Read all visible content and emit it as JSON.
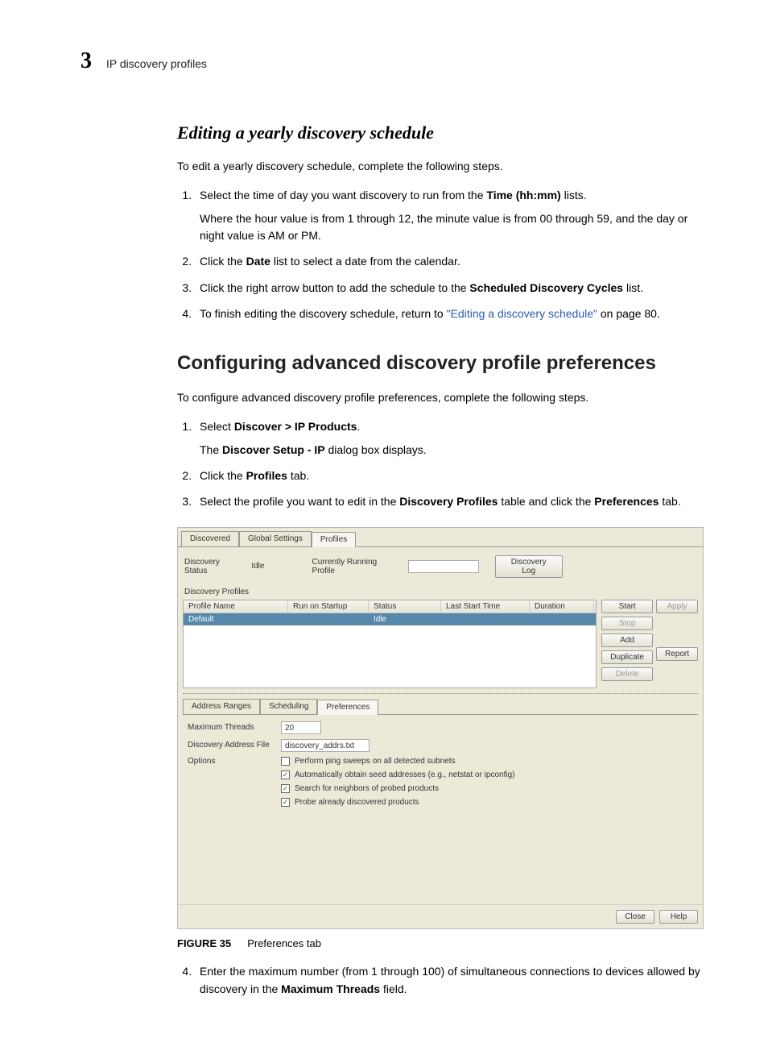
{
  "header": {
    "chapter_number": "3",
    "running_title": "IP discovery profiles"
  },
  "section1": {
    "heading": "Editing a yearly discovery schedule",
    "intro": "To edit a yearly discovery schedule, complete the following steps.",
    "steps": {
      "s1_a": "Select the time of day you want discovery to run from the ",
      "s1_bold": "Time (hh:mm)",
      "s1_b": " lists.",
      "s1_detail": "Where the hour value is from 1 through 12, the minute value is from 00 through 59, and the day or night value is AM or PM.",
      "s2_a": "Click the ",
      "s2_bold": "Date",
      "s2_b": " list to select a date from the calendar.",
      "s3_a": "Click the right arrow button to add the schedule to the ",
      "s3_bold": "Scheduled Discovery Cycles",
      "s3_b": " list.",
      "s4_a": "To finish editing the discovery schedule, return to ",
      "s4_link": "\"Editing a discovery schedule\"",
      "s4_b": " on page 80."
    }
  },
  "section2": {
    "heading": "Configuring advanced discovery profile preferences",
    "intro": "To configure advanced discovery profile preferences, complete the following steps.",
    "steps": {
      "s1_a": "Select ",
      "s1_bold": "Discover > IP Products",
      "s1_period": ".",
      "s1_detail_a": "The ",
      "s1_detail_bold": "Discover Setup - IP",
      "s1_detail_b": " dialog box displays.",
      "s2_a": "Click the ",
      "s2_bold": "Profiles",
      "s2_b": " tab.",
      "s3_a": "Select the profile you want to edit in the ",
      "s3_bold1": "Discovery Profiles",
      "s3_mid": " table and click the ",
      "s3_bold2": "Preferences",
      "s3_b": " tab.",
      "s4_a": "Enter the maximum number (from 1 through 100) of simultaneous connections to devices allowed by discovery in the ",
      "s4_bold": "Maximum Threads",
      "s4_b": " field."
    }
  },
  "dialog": {
    "top_tabs": [
      "Discovered",
      "Global Settings",
      "Profiles"
    ],
    "status": {
      "label": "Discovery Status",
      "value": "Idle",
      "running_label": "Currently Running Profile",
      "log_button": "Discovery Log"
    },
    "group_label": "Discovery Profiles",
    "table": {
      "cols": [
        "Profile Name",
        "Run on Startup",
        "Status",
        "Last Start Time",
        "Duration"
      ],
      "row": {
        "name": "Default",
        "run": "",
        "status": "Idle",
        "last": "",
        "dur": ""
      }
    },
    "side_btns_col1": [
      "Start",
      "Stop",
      "Add",
      "Duplicate",
      "Delete"
    ],
    "side_btns_col2": [
      "Apply",
      "Report"
    ],
    "inner_tabs": [
      "Address Ranges",
      "Scheduling",
      "Preferences"
    ],
    "prefs": {
      "max_threads_label": "Maximum Threads",
      "max_threads_value": "20",
      "addr_file_label": "Discovery Address File",
      "addr_file_value": "discovery_addrs.txt",
      "options_label": "Options",
      "chk1": "Perform ping sweeps on all detected subnets",
      "chk2": "Automatically obtain seed addresses (e.g., netstat or ipconfig)",
      "chk3": "Search for neighbors of probed products",
      "chk4": "Probe already discovered products"
    },
    "foot": {
      "close": "Close",
      "help": "Help"
    }
  },
  "figure_caption": {
    "label": "FIGURE 35",
    "text": "Preferences tab"
  }
}
